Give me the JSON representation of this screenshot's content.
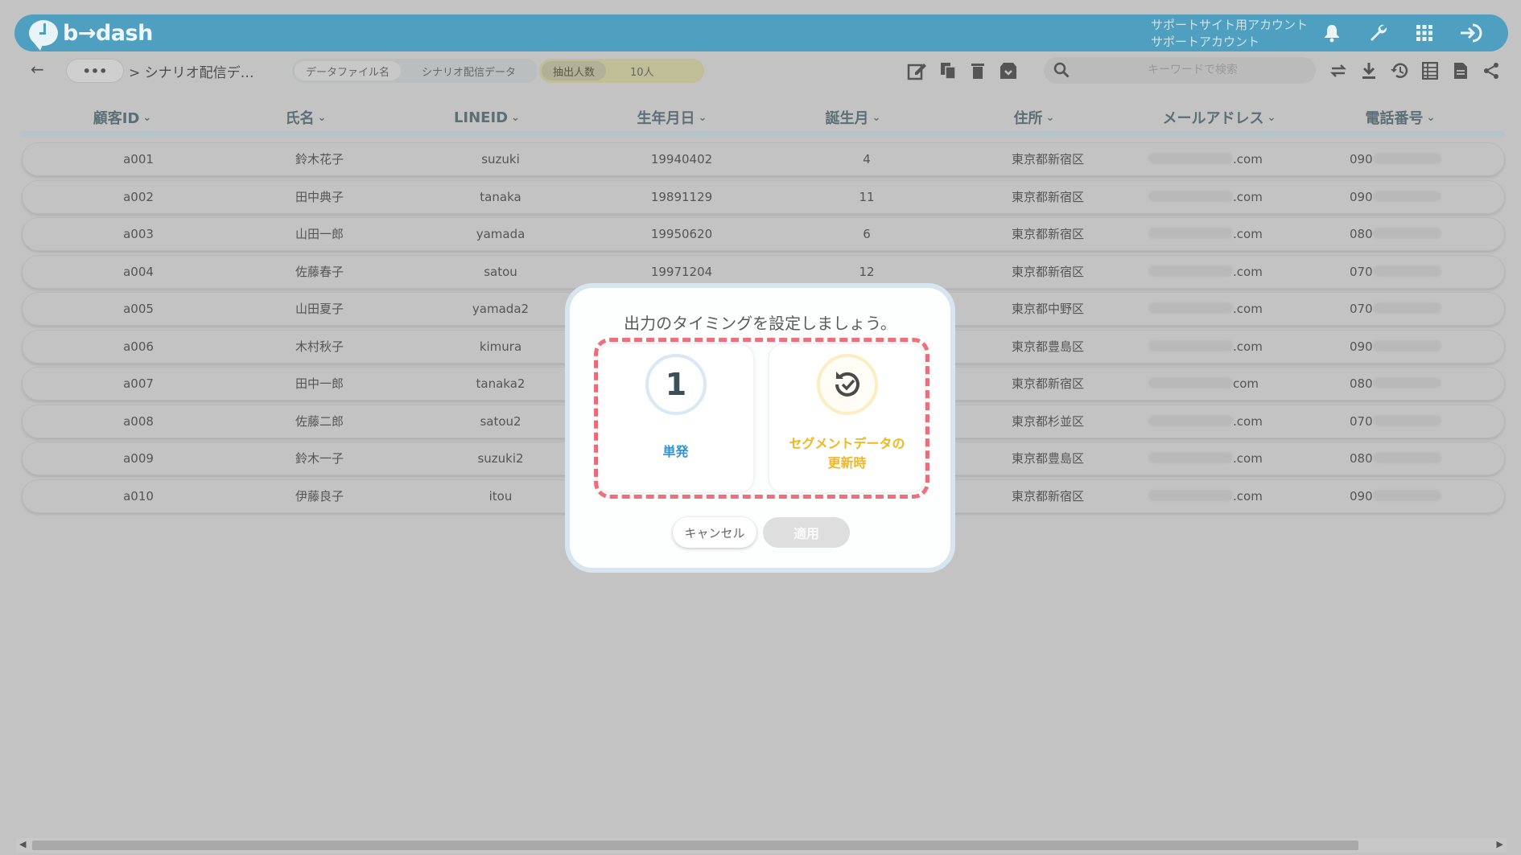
{
  "app": {
    "logo_text": "b→dash",
    "account_line1": "サポートサイト用アカウント",
    "account_line2": "サポートアカウント"
  },
  "toolbar": {
    "back_icon": "arrow-left-icon",
    "more_label": "•••",
    "breadcrumb": "> シナリオ配信デ…",
    "file_tab_label": "データファイル名",
    "file_tab_value": "シナリオ配信データ",
    "count_label": "抽出人数",
    "count_value": "10人",
    "search_placeholder": "キーワードで検索"
  },
  "table": {
    "columns": [
      "顧客ID",
      "氏名",
      "LINEID",
      "生年月日",
      "誕生月",
      "住所",
      "メールアドレス",
      "電話番号"
    ],
    "rows": [
      {
        "id": "a001",
        "name": "鈴木花子",
        "lineid": "suzuki",
        "birth": "19940402",
        "month": "4",
        "address": "東京都新宿区",
        "email_suffix": ".com",
        "phone_prefix": "090"
      },
      {
        "id": "a002",
        "name": "田中典子",
        "lineid": "tanaka",
        "birth": "19891129",
        "month": "11",
        "address": "東京都新宿区",
        "email_suffix": ".com",
        "phone_prefix": "090"
      },
      {
        "id": "a003",
        "name": "山田一郎",
        "lineid": "yamada",
        "birth": "19950620",
        "month": "6",
        "address": "東京都新宿区",
        "email_suffix": ".com",
        "phone_prefix": "080"
      },
      {
        "id": "a004",
        "name": "佐藤春子",
        "lineid": "satou",
        "birth": "19971204",
        "month": "12",
        "address": "東京都新宿区",
        "email_suffix": ".com",
        "phone_prefix": "070"
      },
      {
        "id": "a005",
        "name": "山田夏子",
        "lineid": "yamada2",
        "birth": "",
        "month": "",
        "address": "東京都中野区",
        "email_suffix": ".com",
        "phone_prefix": "070"
      },
      {
        "id": "a006",
        "name": "木村秋子",
        "lineid": "kimura",
        "birth": "",
        "month": "",
        "address": "東京都豊島区",
        "email_suffix": ".com",
        "phone_prefix": "090"
      },
      {
        "id": "a007",
        "name": "田中一郎",
        "lineid": "tanaka2",
        "birth": "",
        "month": "",
        "address": "東京都新宿区",
        "email_suffix": "com",
        "phone_prefix": "080"
      },
      {
        "id": "a008",
        "name": "佐藤二郎",
        "lineid": "satou2",
        "birth": "",
        "month": "",
        "address": "東京都杉並区",
        "email_suffix": ".com",
        "phone_prefix": "070"
      },
      {
        "id": "a009",
        "name": "鈴木一子",
        "lineid": "suzuki2",
        "birth": "",
        "month": "",
        "address": "東京都豊島区",
        "email_suffix": ".com",
        "phone_prefix": "080"
      },
      {
        "id": "a010",
        "name": "伊藤良子",
        "lineid": "itou",
        "birth": "",
        "month": "",
        "address": "東京都新宿区",
        "email_suffix": ".com",
        "phone_prefix": "090"
      }
    ]
  },
  "modal": {
    "title": "出力のタイミングを設定しましょう。",
    "option_once_number": "1",
    "option_once_label": "単発",
    "option_segment_label_line1": "セグメントデータの",
    "option_segment_label_line2": "更新時",
    "cancel_label": "キャンセル",
    "apply_label": "適用",
    "highlight_color": "#ef6f7d",
    "once_color": "#2f93d4",
    "segment_color": "#f2b620"
  },
  "colors": {
    "header_bg": "#4f9fc0",
    "overlay_bg": "#c3c3c3"
  }
}
